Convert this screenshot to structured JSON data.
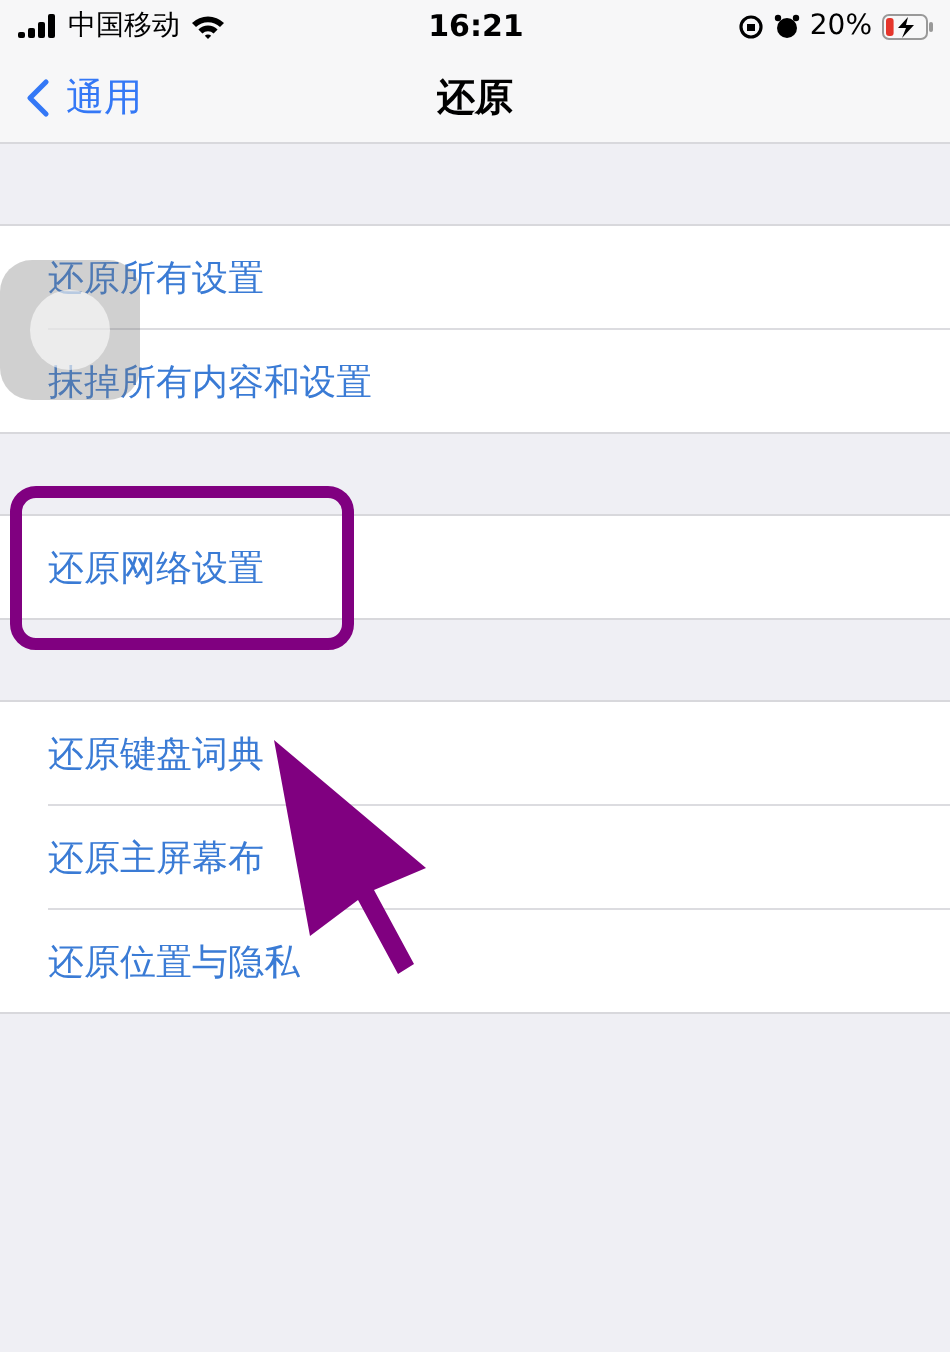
{
  "status_bar": {
    "carrier": "中国移动",
    "time": "16:21",
    "battery_percent": "20%"
  },
  "nav": {
    "back_label": "通用",
    "title": "还原"
  },
  "groups": [
    {
      "items": [
        {
          "label": "还原所有设置"
        },
        {
          "label": "抹掉所有内容和设置"
        }
      ]
    },
    {
      "items": [
        {
          "label": "还原网络设置",
          "highlighted": true
        }
      ]
    },
    {
      "items": [
        {
          "label": "还原键盘词典"
        },
        {
          "label": "还原主屏幕布"
        },
        {
          "label": "还原位置与隐私"
        }
      ]
    }
  ]
}
